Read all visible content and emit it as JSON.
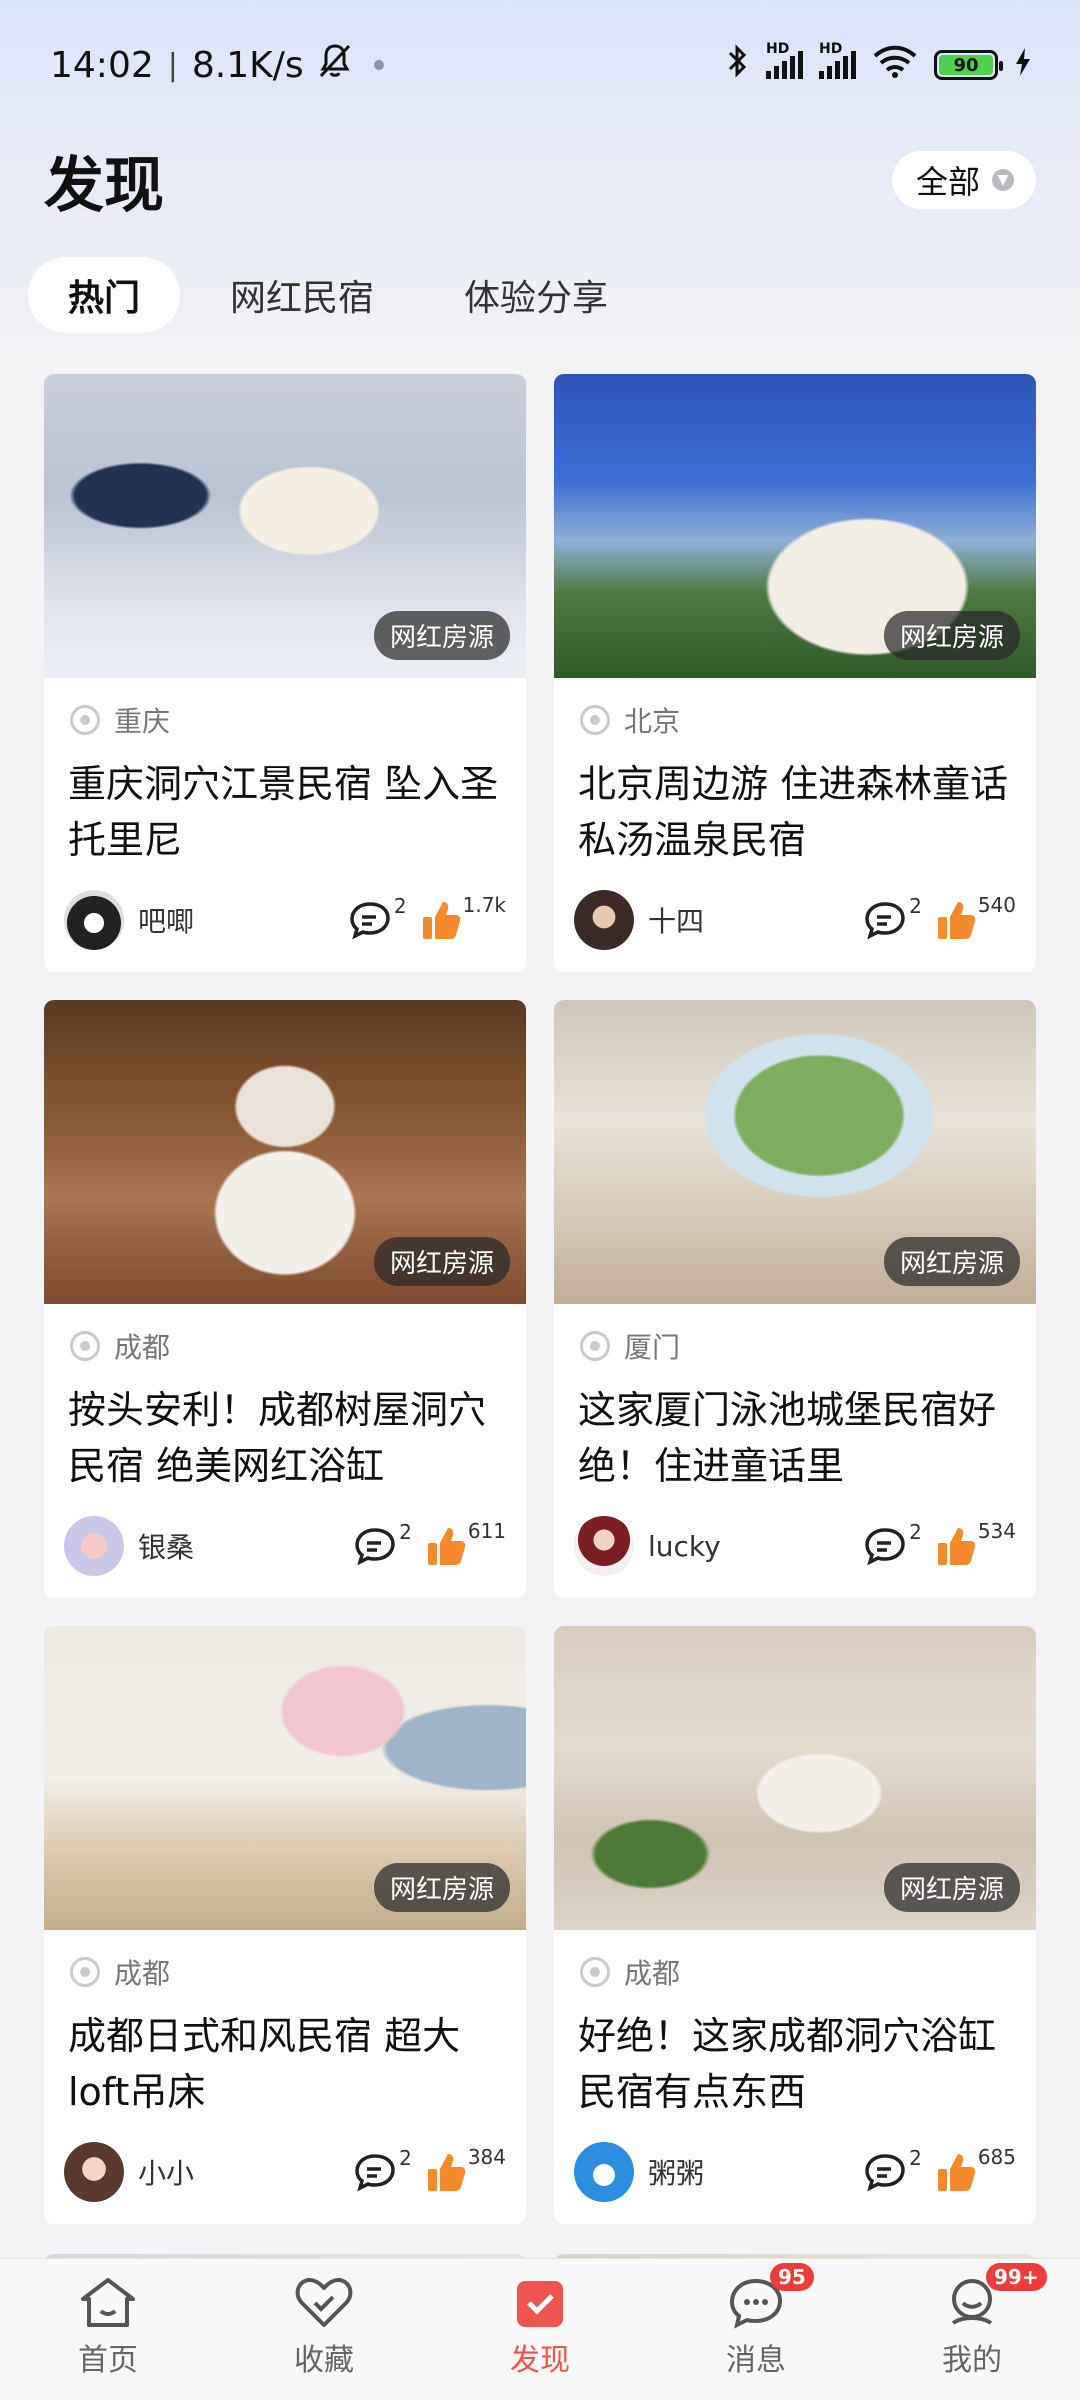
{
  "status_bar": {
    "time": "14:02",
    "net_speed": "8.1K/s",
    "battery": "90"
  },
  "header": {
    "title": "发现",
    "filter_label": "全部"
  },
  "tabs": [
    {
      "label": "热门",
      "active": true
    },
    {
      "label": "网红民宿",
      "active": false
    },
    {
      "label": "体验分享",
      "active": false
    }
  ],
  "cards": [
    {
      "badge": "网红房源",
      "location": "重庆",
      "title": "重庆洞穴江景民宿 坠入圣托里尼",
      "author": "吧唧",
      "comments": "2",
      "likes": "1.7k"
    },
    {
      "badge": "网红房源",
      "location": "北京",
      "title": "北京周边游 住进森林童话 私汤温泉民宿",
      "author": "十四",
      "comments": "2",
      "likes": "540"
    },
    {
      "badge": "网红房源",
      "location": "成都",
      "title": "按头安利！成都树屋洞穴民宿 绝美网红浴缸",
      "author": "银桑",
      "comments": "2",
      "likes": "611"
    },
    {
      "badge": "网红房源",
      "location": "厦门",
      "title": "这家厦门泳池城堡民宿好绝！住进童话里",
      "author": "lucky",
      "comments": "2",
      "likes": "534"
    },
    {
      "badge": "网红房源",
      "location": "成都",
      "title": "成都日式和风民宿 超大loft吊床",
      "author": "小小",
      "comments": "2",
      "likes": "384"
    },
    {
      "badge": "网红房源",
      "location": "成都",
      "title": "好绝！这家成都洞穴浴缸民宿有点东西",
      "author": "粥粥",
      "comments": "2",
      "likes": "685"
    }
  ],
  "bottom_nav": [
    {
      "label": "首页",
      "icon": "home-icon"
    },
    {
      "label": "收藏",
      "icon": "heart-icon"
    },
    {
      "label": "发现",
      "icon": "discover-icon",
      "active": true
    },
    {
      "label": "消息",
      "icon": "message-icon",
      "badge": "95"
    },
    {
      "label": "我的",
      "icon": "profile-icon",
      "badge": "99+"
    }
  ],
  "colors": {
    "accent": "#f0544f",
    "like": "#f58a2a"
  }
}
